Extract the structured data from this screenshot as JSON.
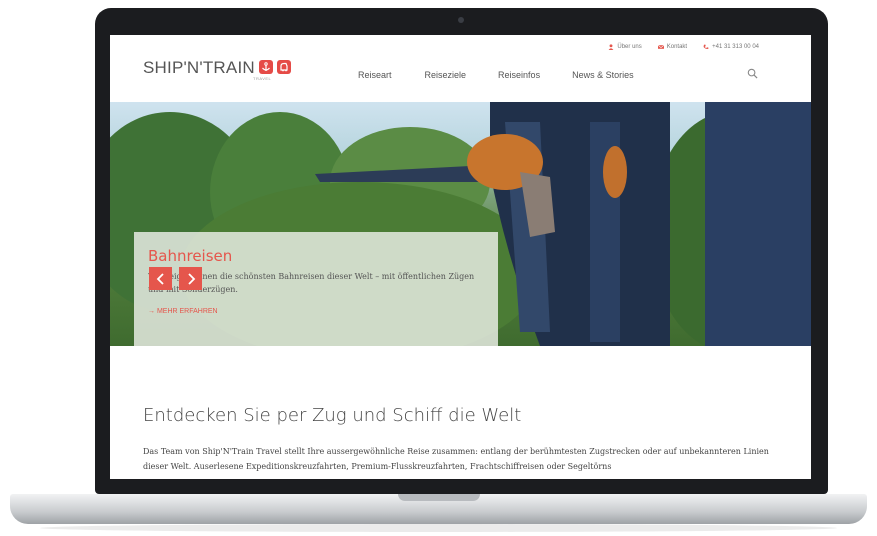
{
  "utility": {
    "about": "Über uns",
    "contact": "Kontakt",
    "phone": "+41 31 313 00 04"
  },
  "logo": {
    "text": "SHIP'N'TRAIN",
    "sub": "TRAVEL"
  },
  "nav": {
    "items": [
      "Reiseart",
      "Reiseziele",
      "Reiseinfos",
      "News & Stories"
    ]
  },
  "hero": {
    "title": "Bahnreisen",
    "text": "Wir zeigen Ihnen die schönsten Bahnreisen dieser Welt – mit öffentlichen Zügen und mit Sonderzügen.",
    "link": "→ MEHR ERFAHREN"
  },
  "content": {
    "heading": "Entdecken Sie per Zug und Schiff die Welt",
    "paragraph": "Das Team von Ship'N'Train Travel stellt Ihre aussergewöhnliche Reise zusammen: entlang der berühmtesten Zugstrecken oder auf unbekannteren Linien dieser Welt. Auserlesene Expeditionskreuzfahrten, Premium-Flusskreuzfahrten, Frachtschiffreisen oder Segeltörns"
  },
  "colors": {
    "accent": "#e5564c",
    "frame": "#1b1c1f"
  },
  "icons": [
    "user-icon",
    "mail-icon",
    "phone-icon",
    "anchor-icon",
    "train-icon",
    "search-icon",
    "chevron-left-icon",
    "chevron-right-icon",
    "camera-icon"
  ]
}
